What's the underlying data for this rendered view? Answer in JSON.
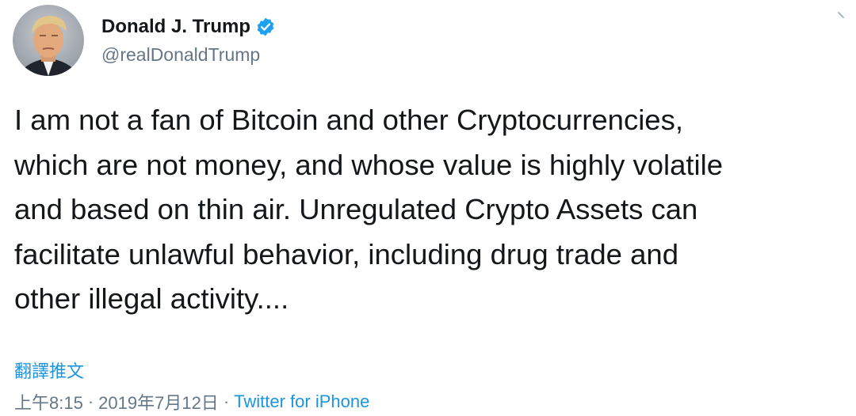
{
  "author": {
    "display_name": "Donald J. Trump",
    "handle": "@realDonaldTrump",
    "verified": true,
    "verified_icon": "verified-badge-icon",
    "verified_color": "#1da1f2"
  },
  "tweet": {
    "lines": [
      "I am not a fan of Bitcoin and other Cryptocurrencies,",
      "which are not money, and whose value is highly volatile",
      "and based on thin air. Unregulated Crypto Assets can",
      "facilitate unlawful behavior, including drug trade and",
      "other illegal activity...."
    ],
    "translate_label": "翻譯推文"
  },
  "meta": {
    "time": "上午8:15",
    "separator": "·",
    "date": "2019年7月12日",
    "source": "Twitter for iPhone"
  },
  "colors": {
    "link": "#1b95e0",
    "secondary_text": "#657786",
    "primary_text": "#14171a"
  }
}
